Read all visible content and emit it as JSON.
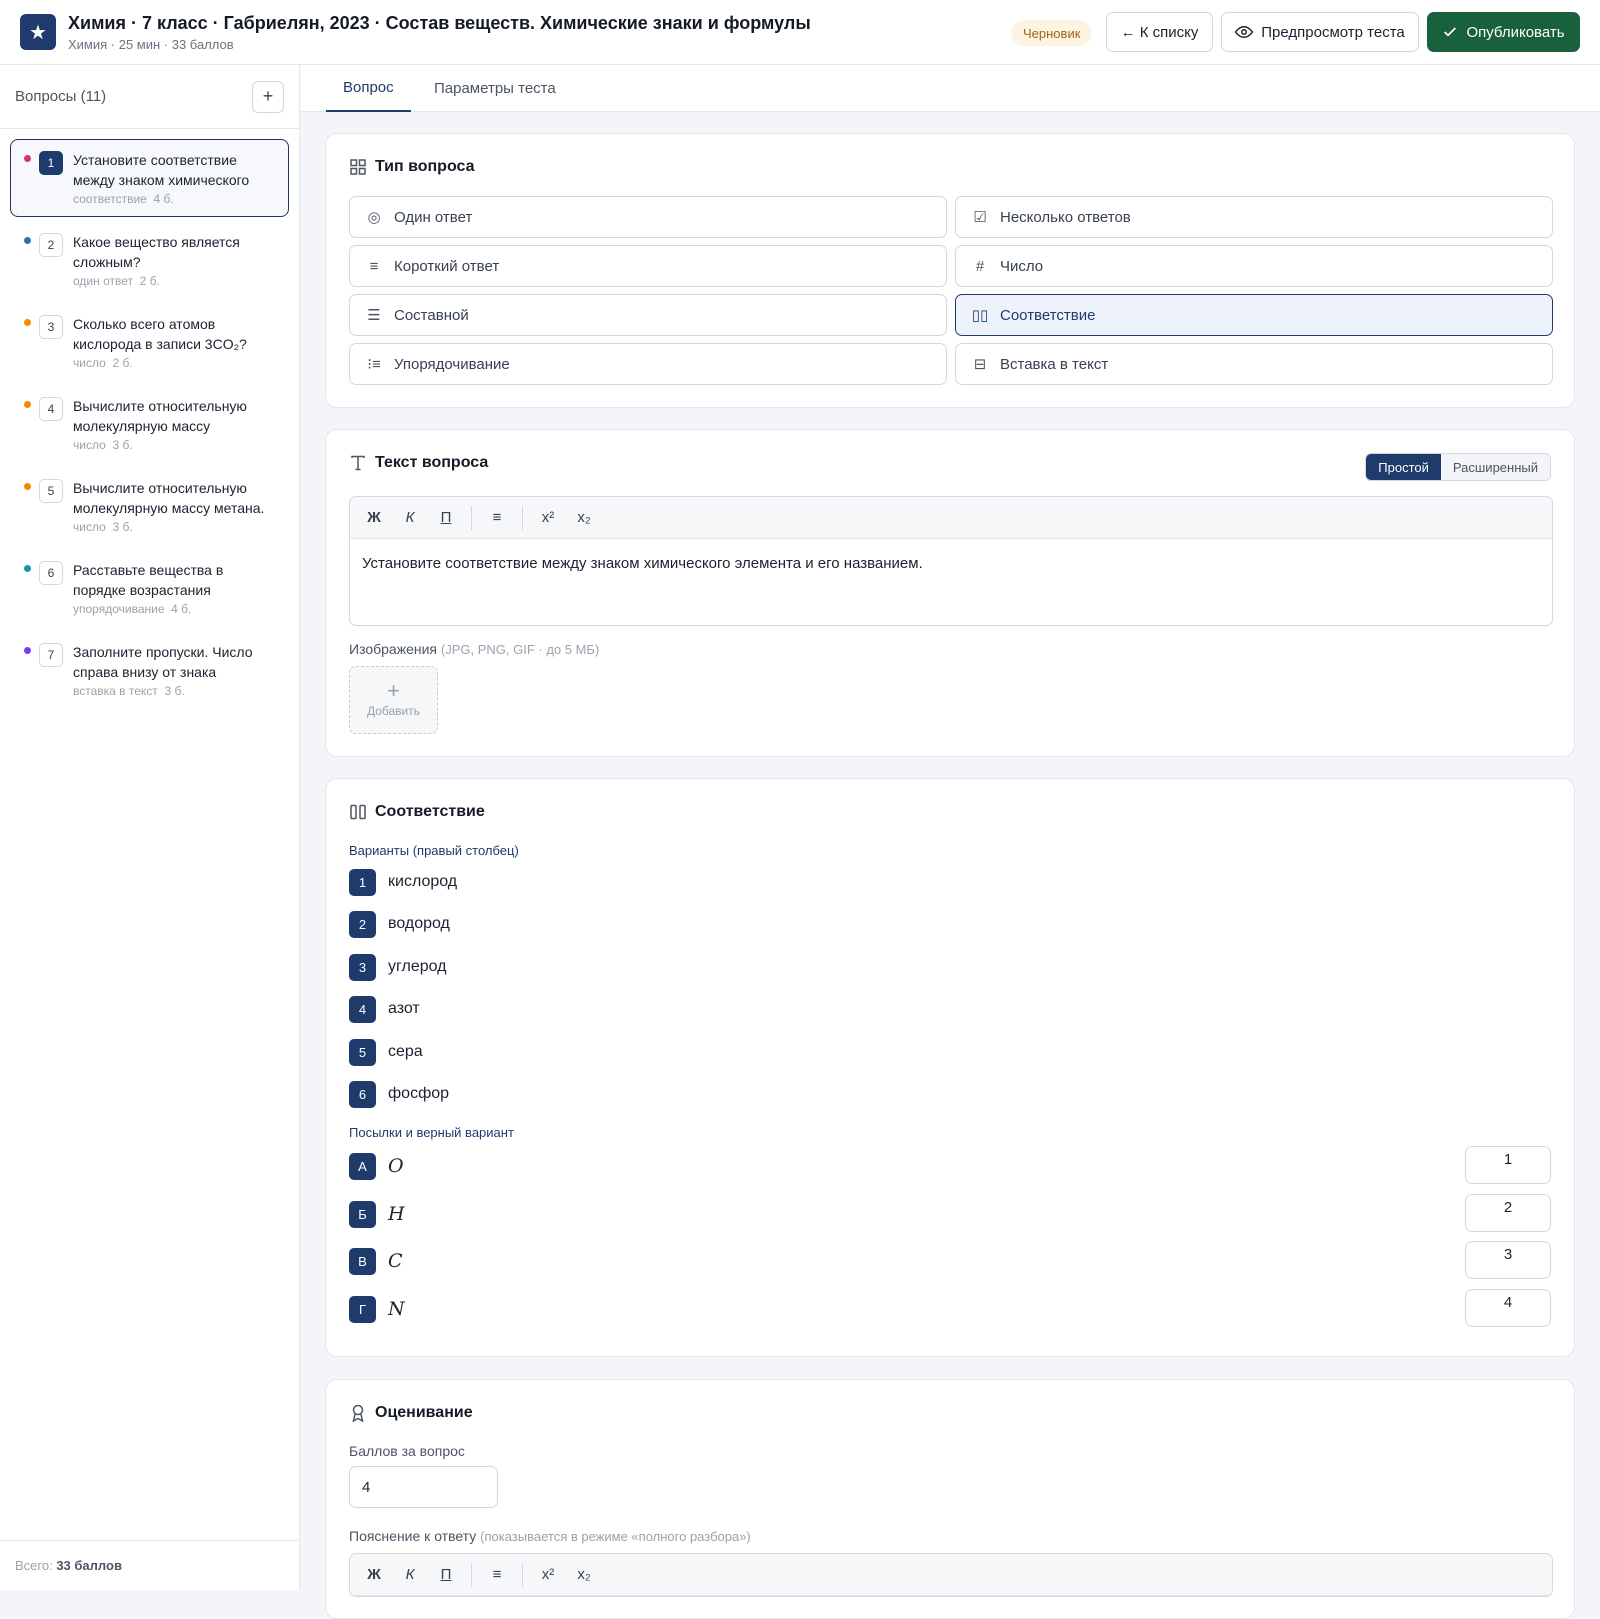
{
  "header": {
    "logo_glyph": "★",
    "title": "Химия · 7 класс · Габриелян, 2023 · Состав веществ. Химические знаки и формулы",
    "subtitle": "Химия · 25 мин · 33 баллов",
    "status_badge": "Черновик",
    "back_label": "← К списку",
    "preview_label": "Предпросмотр теста",
    "publish_label": "Опубликовать"
  },
  "sidebar": {
    "title": "Вопросы (11)",
    "add_glyph": "+",
    "total_prefix": "Всего: ",
    "total_value": "33 баллов",
    "items": [
      {
        "num": "1",
        "text": "Установите соответствие между знаком химического элемента и его названием.",
        "type": "соответствие",
        "points": "4 б.",
        "dot_color": "#d6336c",
        "active": true
      },
      {
        "num": "2",
        "text": "Какое вещество является сложным?",
        "type": "один ответ",
        "points": "2 б.",
        "dot_color": "#2f6db5",
        "active": false
      },
      {
        "num": "3",
        "text": "Сколько всего атомов кислорода в записи 3CO₂?",
        "type": "число",
        "points": "2 б.",
        "dot_color": "#f08c00",
        "active": false
      },
      {
        "num": "4",
        "text": "Вычислите относительную молекулярную массу углекислого газа.",
        "type": "число",
        "points": "3 б.",
        "dot_color": "#f08c00",
        "active": false
      },
      {
        "num": "5",
        "text": "Вычислите относительную молекулярную массу метана.",
        "type": "число",
        "points": "3 б.",
        "dot_color": "#f08c00",
        "active": false
      },
      {
        "num": "6",
        "text": "Расставьте вещества в порядке возрастания относительной молекулярной массы.",
        "type": "упорядочивание",
        "points": "4 б.",
        "dot_color": "#1098ad",
        "active": false
      },
      {
        "num": "7",
        "text": "Заполните пропуски. Число справа внизу от знака элемента называется индексом.",
        "type": "вставка в текст",
        "points": "3 б.",
        "dot_color": "#7c3aed",
        "active": false
      }
    ]
  },
  "tabs": {
    "question": "Вопрос",
    "params": "Параметры теста"
  },
  "question_type": {
    "title": "Тип вопроса",
    "options": [
      {
        "label": "Один ответ",
        "icon": "radio-icon",
        "glyph": "◎"
      },
      {
        "label": "Несколько ответов",
        "icon": "checkbox-icon",
        "glyph": "☑"
      },
      {
        "label": "Короткий ответ",
        "icon": "text-lines-icon",
        "glyph": "≡"
      },
      {
        "label": "Число",
        "icon": "hash-icon",
        "glyph": "#"
      },
      {
        "label": "Составной",
        "icon": "list-icon",
        "glyph": "☰"
      },
      {
        "label": "Соответствие",
        "icon": "columns-icon",
        "glyph": "▯▯"
      },
      {
        "label": "Упорядочивание",
        "icon": "ordered-list-icon",
        "glyph": "⁝≡"
      },
      {
        "label": "Вставка в текст",
        "icon": "insert-text-icon",
        "glyph": "⊟"
      }
    ],
    "selected": "Соответствие"
  },
  "question_text": {
    "title": "Текст вопроса",
    "mode_simple": "Простой",
    "mode_advanced": "Расширенный",
    "toolbar": {
      "bold": "Ж",
      "italic": "К",
      "underline": "П",
      "list": "≡",
      "sup": "x²",
      "sub": "x₂"
    },
    "content": "Установите соответствие между знаком химического элемента и его названием.",
    "images_label": "Изображения",
    "images_hint": "(JPG, PNG, GIF · до 5 МБ)",
    "add_image_glyph": "+",
    "add_image_label": "Добавить"
  },
  "matching": {
    "title": "Соответствие",
    "options_label": "Варианты (правый столбец)",
    "options": [
      {
        "num": "1",
        "text": "кислород"
      },
      {
        "num": "2",
        "text": "водород"
      },
      {
        "num": "3",
        "text": "углерод"
      },
      {
        "num": "4",
        "text": "азот"
      },
      {
        "num": "5",
        "text": "сера"
      },
      {
        "num": "6",
        "text": "фосфор"
      }
    ],
    "premises_label": "Посылки и верный вариант",
    "premises": [
      {
        "letter": "А",
        "symbol": "O",
        "answer": "1"
      },
      {
        "letter": "Б",
        "symbol": "H",
        "answer": "2"
      },
      {
        "letter": "В",
        "symbol": "C",
        "answer": "3"
      },
      {
        "letter": "Г",
        "symbol": "N",
        "answer": "4"
      }
    ]
  },
  "grading": {
    "title": "Оценивание",
    "points_label": "Баллов за вопрос",
    "points_value": "4",
    "explanation_label": "Пояснение к ответу",
    "explanation_hint": "(показывается в режиме «полного разбора»)",
    "toolbar": {
      "bold": "Ж",
      "italic": "К",
      "underline": "П",
      "list": "≡",
      "sup": "x²",
      "sub": "x₂"
    }
  },
  "colors": {
    "primary": "#1f3b6b",
    "publish": "#19603c",
    "draft_bg": "#fdf4e2",
    "draft_text": "#a26414"
  }
}
